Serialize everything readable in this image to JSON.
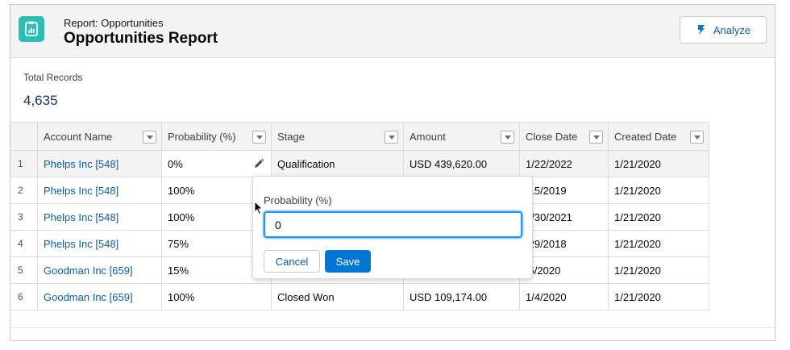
{
  "header": {
    "subtitle": "Report: Opportunities",
    "title": "Opportunities Report",
    "analyze_label": "Analyze",
    "icon": "report-chart-icon",
    "icon_color": "#2bbfb4"
  },
  "summary": {
    "label": "Total Records",
    "value": "4,635"
  },
  "table": {
    "columns": [
      "Account Name",
      "Probability (%)",
      "Stage",
      "Amount",
      "Close Date",
      "Created Date"
    ],
    "rows": [
      {
        "num": "1",
        "account": "Phelps Inc [548]",
        "probability": "0%",
        "stage": "Qualification",
        "amount": "USD 439,620.00",
        "close": "1/22/2022",
        "created": "1/21/2020"
      },
      {
        "num": "2",
        "account": "Phelps Inc [548]",
        "probability": "100%",
        "stage": "",
        "amount": "",
        "close": "/15/2019",
        "created": "1/21/2020"
      },
      {
        "num": "3",
        "account": "Phelps Inc [548]",
        "probability": "100%",
        "stage": "",
        "amount": "",
        "close": "1/30/2021",
        "created": "1/21/2020"
      },
      {
        "num": "4",
        "account": "Phelps Inc [548]",
        "probability": "75%",
        "stage": "",
        "amount": "",
        "close": "/29/2018",
        "created": "1/21/2020"
      },
      {
        "num": "5",
        "account": "Goodman Inc [659]",
        "probability": "15%",
        "stage": "",
        "amount": "",
        "close": "/5/2020",
        "created": "1/21/2020"
      },
      {
        "num": "6",
        "account": "Goodman Inc [659]",
        "probability": "100%",
        "stage": "Closed Won",
        "amount": "USD 109,174.00",
        "close": "1/4/2020",
        "created": "1/21/2020"
      }
    ]
  },
  "popover": {
    "label": "Probability (%)",
    "value": "0",
    "cancel_label": "Cancel",
    "save_label": "Save"
  },
  "colors": {
    "link": "#0b5cab",
    "brand_button": "#0176d3",
    "focus": "#1b96ff"
  }
}
